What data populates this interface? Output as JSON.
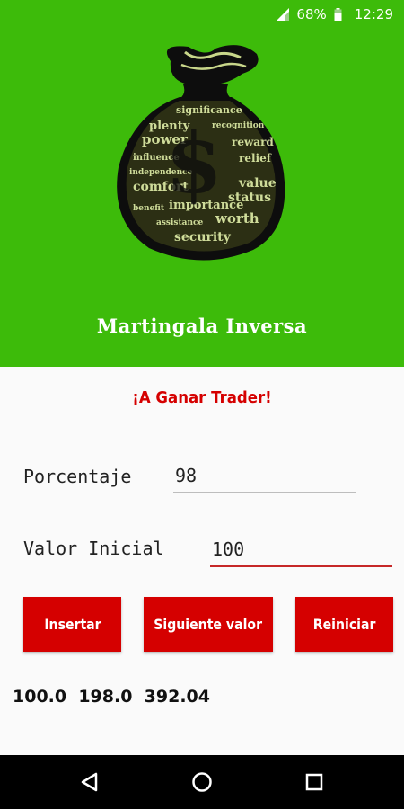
{
  "status_bar": {
    "battery": "68%",
    "time": "12:29",
    "icons": [
      "signal-icon",
      "battery-icon"
    ]
  },
  "header": {
    "title": "Martingala Inversa",
    "logo_icon": "money-bag-icon",
    "background_color": "#3dbb0a"
  },
  "subtitle": "¡A Ganar Trader!",
  "form": {
    "porcentaje": {
      "label": "Porcentaje",
      "value": "98"
    },
    "valor_inicial": {
      "label": "Valor Inicial",
      "value": "100"
    }
  },
  "buttons": {
    "insertar": "Insertar",
    "siguiente": "Siguiente valor",
    "reiniciar": "Reiniciar",
    "color": "#d50000"
  },
  "results": "100.0  198.0  392.04",
  "nav_bar": {
    "icons": [
      "back-icon",
      "home-icon",
      "recent-apps-icon"
    ]
  }
}
